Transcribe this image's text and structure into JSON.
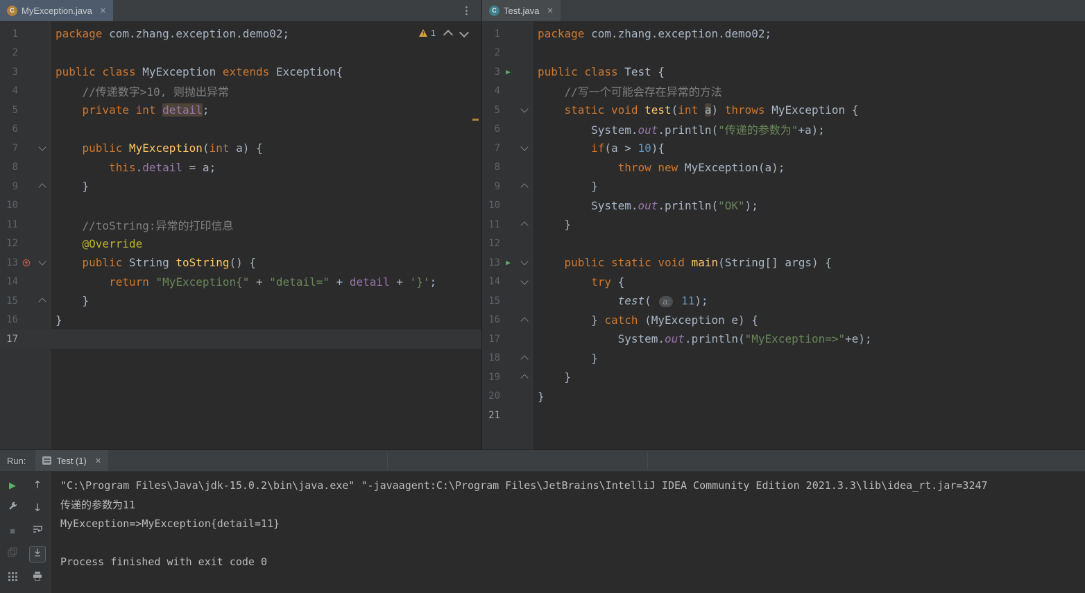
{
  "theme": {
    "editor_background": "#2b2b2b",
    "panel_background": "#3c3f41",
    "keyword": "#cc7832",
    "string": "#6a8759",
    "comment": "#808080",
    "number": "#6897bb",
    "field": "#9876aa",
    "method": "#ffc66b",
    "annotation": "#bbb529",
    "default_text": "#a9b7c6",
    "run_green": "#5fad65",
    "warning_yellow": "#d9a343",
    "identifier_highlight": "#4e4338"
  },
  "left_pane": {
    "tab": {
      "title": "MyException.java",
      "close": "✕",
      "icon": "java-class-icon"
    },
    "more_icon": "⋮",
    "inspection": {
      "warning_count": "1"
    },
    "editor": {
      "current_line": 17,
      "row_highlight": true,
      "lines": [
        {
          "t": [
            [
              "kw",
              "package"
            ],
            [
              "d",
              " com.zhang.exception.demo02;"
            ]
          ]
        },
        {
          "t": []
        },
        {
          "t": [
            [
              "kw",
              "public class "
            ],
            [
              "d",
              "MyException "
            ],
            [
              "kw",
              "extends "
            ],
            [
              "d",
              "Exception{"
            ]
          ]
        },
        {
          "t": [
            [
              "d",
              "    "
            ],
            [
              "c",
              "//传递数字>10, 则抛出异常"
            ]
          ]
        },
        {
          "t": [
            [
              "d",
              "    "
            ],
            [
              "kw",
              "private int "
            ],
            [
              "fh",
              "detail"
            ],
            [
              "d",
              ";"
            ]
          ]
        },
        {
          "t": []
        },
        {
          "t": [
            [
              "d",
              "    "
            ],
            [
              "kw",
              "public "
            ],
            [
              "m",
              "MyException"
            ],
            [
              "d",
              "("
            ],
            [
              "kw",
              "int"
            ],
            [
              "d",
              " a) {"
            ]
          ],
          "gb": "fold-down"
        },
        {
          "t": [
            [
              "d",
              "        "
            ],
            [
              "kw",
              "this"
            ],
            [
              "d",
              "."
            ],
            [
              "f",
              "detail"
            ],
            [
              "d",
              " = a;"
            ]
          ]
        },
        {
          "t": [
            [
              "d",
              "    }"
            ]
          ],
          "gb": "fold-up"
        },
        {
          "t": []
        },
        {
          "t": [
            [
              "d",
              "    "
            ],
            [
              "c",
              "//toString:异常的打印信息"
            ]
          ]
        },
        {
          "t": [
            [
              "d",
              "    "
            ],
            [
              "a",
              "@Override"
            ]
          ]
        },
        {
          "t": [
            [
              "d",
              "    "
            ],
            [
              "kw",
              "public "
            ],
            [
              "d",
              "String "
            ],
            [
              "m",
              "toString"
            ],
            [
              "d",
              "() {"
            ]
          ],
          "ga": "override",
          "gb": "fold-down"
        },
        {
          "t": [
            [
              "d",
              "        "
            ],
            [
              "kw",
              "return "
            ],
            [
              "s",
              "\"MyException{\""
            ],
            [
              "d",
              " + "
            ],
            [
              "s",
              "\"detail=\""
            ],
            [
              "d",
              " + "
            ],
            [
              "f",
              "detail"
            ],
            [
              "d",
              " + "
            ],
            [
              "s",
              "'}'"
            ],
            [
              "d",
              ";"
            ]
          ]
        },
        {
          "t": [
            [
              "d",
              "    }"
            ]
          ],
          "gb": "fold-up"
        },
        {
          "t": [
            [
              "d",
              "}"
            ]
          ]
        },
        {
          "t": []
        }
      ]
    }
  },
  "right_pane": {
    "tab": {
      "title": "Test.java",
      "close": "✕",
      "icon": "java-class-icon"
    },
    "editor": {
      "current_line": 21,
      "row_highlight": false,
      "lines": [
        {
          "t": [
            [
              "kw",
              "package"
            ],
            [
              "d",
              " com.zhang.exception.demo02;"
            ]
          ]
        },
        {
          "t": []
        },
        {
          "t": [
            [
              "kw",
              "public class "
            ],
            [
              "d",
              "Test {"
            ]
          ],
          "ga": "run"
        },
        {
          "t": [
            [
              "d",
              "    "
            ],
            [
              "c",
              "//写一个可能会存在异常的方法"
            ]
          ]
        },
        {
          "t": [
            [
              "d",
              "    "
            ],
            [
              "kw",
              "static void "
            ],
            [
              "m",
              "test"
            ],
            [
              "d",
              "("
            ],
            [
              "kw",
              "int"
            ],
            [
              "d",
              " "
            ],
            [
              "ph",
              "a"
            ],
            [
              "d",
              ") "
            ],
            [
              "kw",
              "throws "
            ],
            [
              "d",
              "MyException {"
            ]
          ],
          "gb": "fold-down"
        },
        {
          "t": [
            [
              "d",
              "        System."
            ],
            [
              "sf",
              "out"
            ],
            [
              "d",
              ".println("
            ],
            [
              "s",
              "\"传递的参数为\""
            ],
            [
              "d",
              "+a);"
            ]
          ]
        },
        {
          "t": [
            [
              "d",
              "        "
            ],
            [
              "kw",
              "if"
            ],
            [
              "d",
              "(a > "
            ],
            [
              "n",
              "10"
            ],
            [
              "d",
              "){"
            ]
          ],
          "gb": "fold-down"
        },
        {
          "t": [
            [
              "d",
              "            "
            ],
            [
              "kw",
              "throw new "
            ],
            [
              "d",
              "MyException(a);"
            ]
          ]
        },
        {
          "t": [
            [
              "d",
              "        }"
            ]
          ],
          "gb": "fold-up"
        },
        {
          "t": [
            [
              "d",
              "        System."
            ],
            [
              "sf",
              "out"
            ],
            [
              "d",
              ".println("
            ],
            [
              "s",
              "\"OK\""
            ],
            [
              "d",
              ");"
            ]
          ]
        },
        {
          "t": [
            [
              "d",
              "    }"
            ]
          ],
          "gb": "fold-up"
        },
        {
          "t": []
        },
        {
          "t": [
            [
              "d",
              "    "
            ],
            [
              "kw",
              "public static void "
            ],
            [
              "m",
              "main"
            ],
            [
              "d",
              "(String[] args) {"
            ]
          ],
          "ga": "run",
          "gb": "fold-down"
        },
        {
          "t": [
            [
              "d",
              "        "
            ],
            [
              "kw",
              "try"
            ],
            [
              "d",
              " {"
            ]
          ],
          "gb": "fold-down"
        },
        {
          "t": [
            [
              "d",
              "            "
            ],
            [
              "sm",
              "test"
            ],
            [
              "d",
              "( "
            ],
            [
              "hint",
              "a:"
            ],
            [
              "d",
              " "
            ],
            [
              "n",
              "11"
            ],
            [
              "d",
              ");"
            ]
          ]
        },
        {
          "t": [
            [
              "d",
              "        } "
            ],
            [
              "kw",
              "catch"
            ],
            [
              "d",
              " (MyException e) {"
            ]
          ],
          "gb": "fold-up"
        },
        {
          "t": [
            [
              "d",
              "            System."
            ],
            [
              "sf",
              "out"
            ],
            [
              "d",
              ".println("
            ],
            [
              "s",
              "\"MyException=>\""
            ],
            [
              "d",
              "+e);"
            ]
          ]
        },
        {
          "t": [
            [
              "d",
              "        }"
            ]
          ],
          "gb": "fold-up"
        },
        {
          "t": [
            [
              "d",
              "    }"
            ]
          ],
          "gb": "fold-up"
        },
        {
          "t": [
            [
              "d",
              "}"
            ]
          ]
        },
        {
          "t": []
        }
      ]
    }
  },
  "run_panel": {
    "label": "Run:",
    "tab": {
      "title": "Test (1)",
      "close": "✕",
      "icon": "console-tab-icon"
    },
    "toolbar_left": [
      {
        "name": "rerun-button",
        "icon": "play-icon"
      },
      {
        "name": "settings-button",
        "icon": "wrench-icon"
      },
      {
        "name": "stop-button",
        "icon": "stop-icon"
      },
      {
        "name": "restore-layout-button",
        "icon": "dim-icon"
      },
      {
        "name": "services-grid-button",
        "icon": "grid-icon"
      }
    ],
    "toolbar_console": [
      {
        "name": "prev-occurrence-button",
        "icon": "up-arrow-icon"
      },
      {
        "name": "next-occurrence-button",
        "icon": "down-arrow-icon"
      },
      {
        "name": "soft-wrap-toggle",
        "icon": "soft-wrap-icon"
      },
      {
        "name": "scroll-to-end-toggle",
        "icon": "scroll-end-icon",
        "active": true
      },
      {
        "name": "print-button",
        "icon": "print-icon"
      }
    ],
    "console_lines": [
      "\"C:\\Program Files\\Java\\jdk-15.0.2\\bin\\java.exe\" \"-javaagent:C:\\Program Files\\JetBrains\\IntelliJ IDEA Community Edition 2021.3.3\\lib\\idea_rt.jar=3247",
      "传递的参数为11",
      "MyException=>MyException{detail=11}",
      "",
      "Process finished with exit code 0"
    ]
  }
}
